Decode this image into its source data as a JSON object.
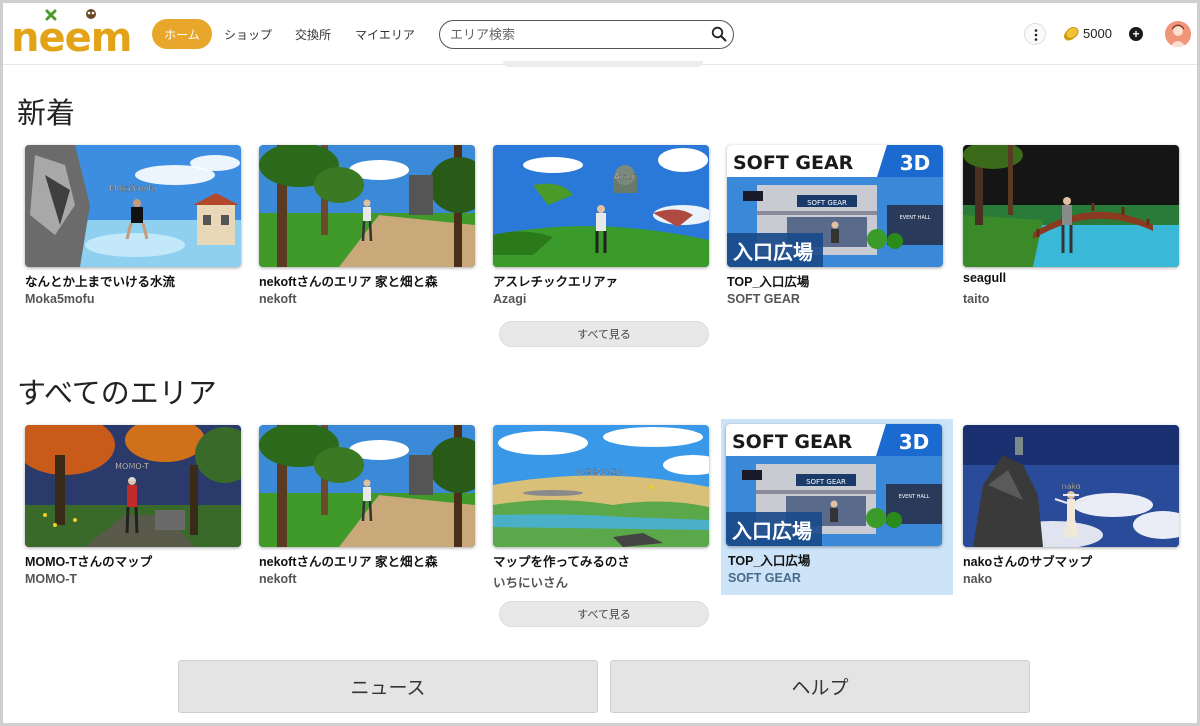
{
  "header": {
    "logo_text": "neem",
    "nav": [
      {
        "label": "ホーム",
        "active": true
      },
      {
        "label": "ショップ",
        "active": false
      },
      {
        "label": "交換所",
        "active": false
      },
      {
        "label": "マイエリア",
        "active": false
      }
    ],
    "search_placeholder": "エリア検索",
    "coins": "5000"
  },
  "sections": [
    {
      "title": "新着",
      "see_all_label": "すべて見る",
      "cards": [
        {
          "title": "なんとか上までいける水流",
          "author": "Moka5mofu",
          "overlay": "Moka5mofu",
          "scene": "water"
        },
        {
          "title": "nekoftさんのエリア 家と畑と森",
          "author": "nekoft",
          "overlay": "",
          "scene": "forest"
        },
        {
          "title": "アスレチックエリアァ",
          "author": "Azagi",
          "overlay": "Azagi",
          "scene": "sky"
        },
        {
          "title": "TOP_入口広場",
          "author": "SOFT GEAR",
          "overlay": "",
          "scene": "softgear"
        },
        {
          "title": "seagull",
          "author": "taito",
          "overlay": "",
          "scene": "bridge"
        }
      ]
    },
    {
      "title": "すべてのエリア",
      "see_all_label": "すべて見る",
      "cards": [
        {
          "title": "MOMO-Tさんのマップ",
          "author": "MOMO-T",
          "overlay": "MOMO-T",
          "scene": "autumn"
        },
        {
          "title": "nekoftさんのエリア 家と畑と森",
          "author": "nekoft",
          "overlay": "",
          "scene": "forest"
        },
        {
          "title": "マップを作ってみるのさ",
          "author": "いちにいさん",
          "overlay": "いちにいさん",
          "scene": "hills"
        },
        {
          "title": "TOP_入口広場",
          "author": "SOFT GEAR",
          "overlay": "",
          "scene": "softgear",
          "selected": true
        },
        {
          "title": "nakoさんのサブマップ",
          "author": "nako",
          "overlay": "nako",
          "scene": "nightrock"
        }
      ]
    }
  ],
  "softgear_banner": {
    "brand": "SOFT GEAR",
    "tag": "3D",
    "caption": "入口広場",
    "sign": "SOFT GEAR",
    "event": "EVENT HALL"
  },
  "footer": {
    "news_label": "ニュース",
    "help_label": "ヘルプ"
  },
  "colors": {
    "accent": "#e8a72a",
    "logo": "#e3a317",
    "selected_bg": "#cde3f8"
  }
}
